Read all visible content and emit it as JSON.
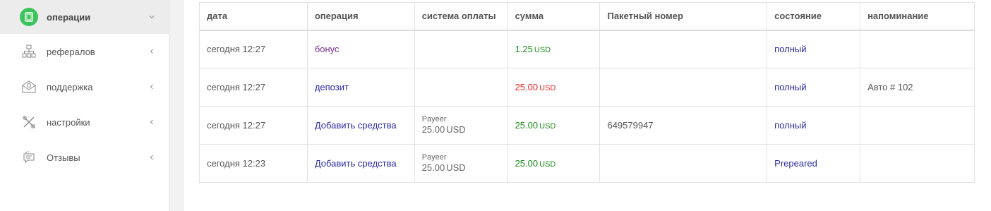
{
  "sidebar": {
    "items": [
      {
        "label": "операции",
        "icon": "document-icon",
        "active": true
      },
      {
        "label": "рефералов",
        "icon": "hierarchy-icon",
        "active": false
      },
      {
        "label": "поддержка",
        "icon": "mail-support-icon",
        "active": false
      },
      {
        "label": "настройки",
        "icon": "tools-icon",
        "active": false
      },
      {
        "label": "Отзывы",
        "icon": "speech-bubble-icon",
        "active": false
      }
    ]
  },
  "table": {
    "headers": [
      "дата",
      "операция",
      "система оплаты",
      "сумма",
      "Пакетный номер",
      "состояние",
      "напоминание"
    ],
    "rows": [
      {
        "date": "сегодня 12:27",
        "operation": "бонус",
        "pay_system_name": "",
        "pay_system_amount": "",
        "pay_system_currency": "",
        "amount": "1.25",
        "amount_currency": "USD",
        "amount_color": "green",
        "batch": "",
        "status": "полный",
        "note": ""
      },
      {
        "date": "сегодня 12:27",
        "operation": "депозит",
        "pay_system_name": "",
        "pay_system_amount": "",
        "pay_system_currency": "",
        "amount": "25.00",
        "amount_currency": "USD",
        "amount_color": "red",
        "batch": "",
        "status": "полный",
        "note": "Авто # 102"
      },
      {
        "date": "сегодня 12:27",
        "operation": "Добавить средства",
        "pay_system_name": "Payeer",
        "pay_system_amount": "25.00",
        "pay_system_currency": "USD",
        "amount": "25.00",
        "amount_currency": "USD",
        "amount_color": "green",
        "batch": "649579947",
        "status": "полный",
        "note": ""
      },
      {
        "date": "сегодня 12:23",
        "operation": "Добавить средства",
        "pay_system_name": "Payeer",
        "pay_system_amount": "25.00",
        "pay_system_currency": "USD",
        "amount": "25.00",
        "amount_currency": "USD",
        "amount_color": "green",
        "batch": "",
        "status": "Prepeared",
        "note": ""
      }
    ]
  },
  "colors": {
    "accent_green": "#3cc45c",
    "amount_green": "#1c8c1c",
    "amount_red": "#e02a2a",
    "link_blue": "#2a2aa6",
    "bonus_purple": "#7a2b8a"
  }
}
